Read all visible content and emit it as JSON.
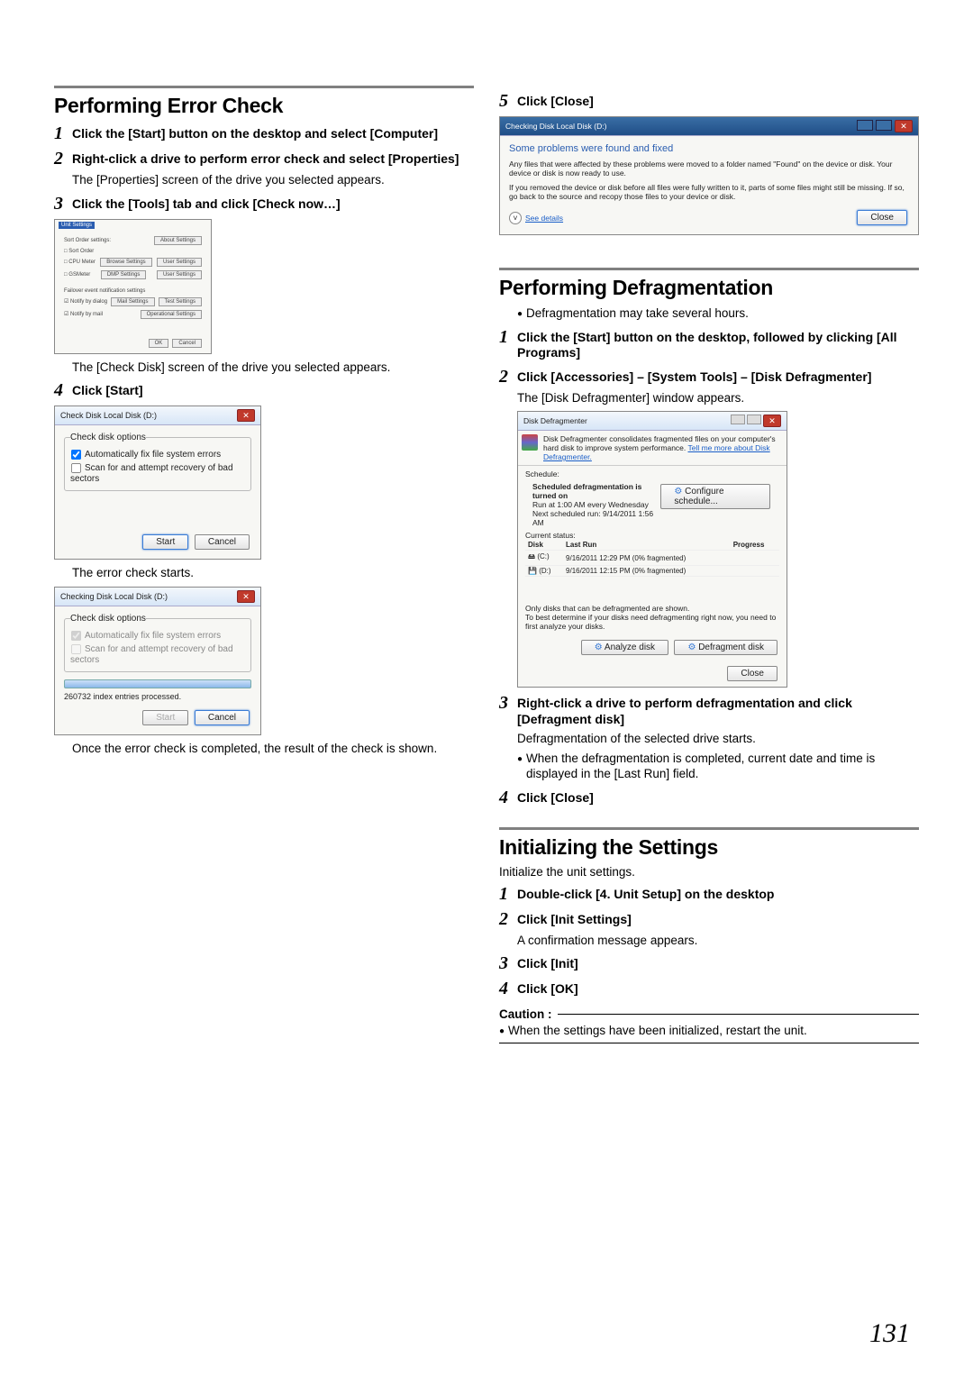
{
  "pageNumber": "131",
  "left": {
    "h_error": "Performing Error Check",
    "s1": "Click the [Start] button on the desktop and select [Computer]",
    "s2": "Right-click a drive to perform error check and select [Properties]",
    "s2_body": "The [Properties] screen of the drive you selected appears.",
    "s3": "Click the [Tools] tab and click [Check now…]",
    "fig1_body": "The [Check Disk] screen of the drive you selected appears.",
    "s4": "Click [Start]",
    "fig2_body": "The error check starts.",
    "fig3_body": "Once the error check is completed, the result of the check is shown."
  },
  "right": {
    "s5": "Click [Close]",
    "h_defrag": "Performing Defragmentation",
    "defrag_bullet": "Defragmentation may take several hours.",
    "d1": "Click the [Start] button on the desktop, followed by clicking [All Programs]",
    "d2": "Click [Accessories] – [System Tools] – [Disk Defragmenter]",
    "d2_body": "The [Disk Defragmenter] window appears.",
    "d3": "Right-click a drive to perform defragmentation and click [Defragment disk]",
    "d3_body": "Defragmentation of the selected drive starts.",
    "d3_bullet": "When the defragmentation is completed, current date and time is displayed in the [Last Run] field.",
    "d4": "Click [Close]",
    "h_init": "Initializing the Settings",
    "init_intro": "Initialize the unit settings.",
    "i1": "Double-click [4. Unit Setup] on the desktop",
    "i2": "Click [Init Settings]",
    "i2_body": "A confirmation message appears.",
    "i3": "Click [Init]",
    "i4": "Click [OK]",
    "caution_label": "Caution :",
    "caution_body": "When the settings have been initialized, restart the unit."
  },
  "mock_checkdisk": {
    "title": "Check Disk Local Disk (D:)",
    "legend": "Check disk options",
    "opt1": "Automatically fix file system errors",
    "opt2": "Scan for and attempt recovery of bad sectors",
    "btn_start": "Start",
    "btn_cancel": "Cancel"
  },
  "mock_checking": {
    "title": "Checking Disk Local Disk (D:)",
    "legend": "Check disk options",
    "opt1": "Automatically fix file system errors",
    "opt2": "Scan for and attempt recovery of bad sectors",
    "status": "260732 index entries processed.",
    "btn_start": "Start",
    "btn_cancel": "Cancel"
  },
  "mock_result": {
    "title": "Checking Disk Local Disk (D:)",
    "heading": "Some problems were found and fixed",
    "body1": "Any files that were affected by these problems were moved to a folder named \"Found\" on the device or disk. Your device or disk is now ready to use.",
    "body2": "If you removed the device or disk before all files were fully written to it, parts of some files might still be missing. If so, go back to the source and recopy those files to your device or disk.",
    "see_details": "See details",
    "btn_close": "Close"
  },
  "mock_defrag": {
    "title": "Disk Defragmenter",
    "intro": "Disk Defragmenter consolidates fragmented files on your computer's hard disk to improve system performance.",
    "intro_link": "Tell me more about Disk Defragmenter.",
    "schedule_label": "Schedule:",
    "sched_on": "Scheduled defragmentation is turned on",
    "sched_time": "Run at 1:00 AM every Wednesday",
    "sched_next": "Next scheduled run: 9/14/2011 1:56 AM",
    "btn_configure": "Configure schedule...",
    "current_label": "Current status:",
    "th_disk": "Disk",
    "th_last": "Last Run",
    "th_prog": "Progress",
    "row1_disk": "(C:)",
    "row1_last": "9/16/2011 12:29 PM (0% fragmented)",
    "row2_disk": "(D:)",
    "row2_last": "9/16/2011 12:15 PM (0% fragmented)",
    "note1": "Only disks that can be defragmented are shown.",
    "note2": "To best determine if your disks need defragmenting right now, you need to first analyze your disks.",
    "btn_analyze": "Analyze disk",
    "btn_defrag": "Defragment disk",
    "btn_close": "Close"
  },
  "mock_tiny": {
    "title": "Unit Settings",
    "btn_ok": "OK",
    "btn_cancel": "Cancel"
  }
}
